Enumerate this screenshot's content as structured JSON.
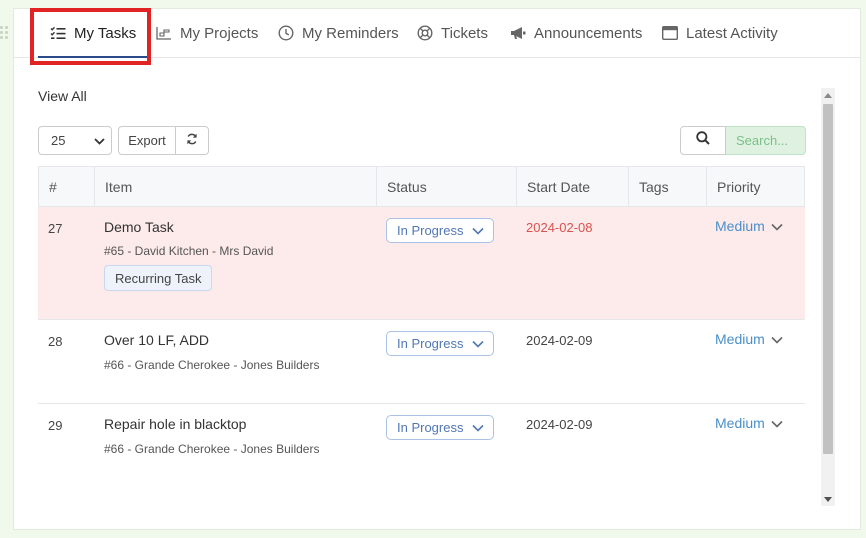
{
  "tabs": [
    {
      "label": "My Tasks",
      "icon": "checklist-icon",
      "active": true
    },
    {
      "label": "My Projects",
      "icon": "chart-icon",
      "active": false
    },
    {
      "label": "My Reminders",
      "icon": "clock-icon",
      "active": false
    },
    {
      "label": "Tickets",
      "icon": "lifebuoy-icon",
      "active": false
    },
    {
      "label": "Announcements",
      "icon": "megaphone-icon",
      "active": false
    },
    {
      "label": "Latest Activity",
      "icon": "window-icon",
      "active": false
    }
  ],
  "view_all": "View All",
  "toolbar": {
    "page_size": "25",
    "export_label": "Export"
  },
  "search": {
    "placeholder": "Search..."
  },
  "table": {
    "columns": [
      "#",
      "Item",
      "Status",
      "Start Date",
      "Tags",
      "Priority"
    ],
    "rows": [
      {
        "num": "27",
        "title": "Demo Task",
        "subtitle": "#65 - David Kitchen - Mrs David",
        "tag": "Recurring Task",
        "status": "In Progress",
        "start_date": "2024-02-08",
        "overdue": true,
        "tags": "",
        "priority": "Medium"
      },
      {
        "num": "28",
        "title": "Over 10 LF, ADD",
        "subtitle": "#66 - Grande Cherokee - Jones Builders",
        "status": "In Progress",
        "start_date": "2024-02-09",
        "overdue": false,
        "tags": "",
        "priority": "Medium"
      },
      {
        "num": "29",
        "title": "Repair hole in blacktop",
        "subtitle": "#66 - Grande Cherokee - Jones Builders",
        "status": "In Progress",
        "start_date": "2024-02-09",
        "overdue": false,
        "tags": "",
        "priority": "Medium"
      }
    ]
  },
  "colors": {
    "overdue_row": "#fdeaea",
    "overdue_date": "#d9534f",
    "status": "#5177b5",
    "priority": "#4a8fc9",
    "highlight": "#e02424"
  }
}
